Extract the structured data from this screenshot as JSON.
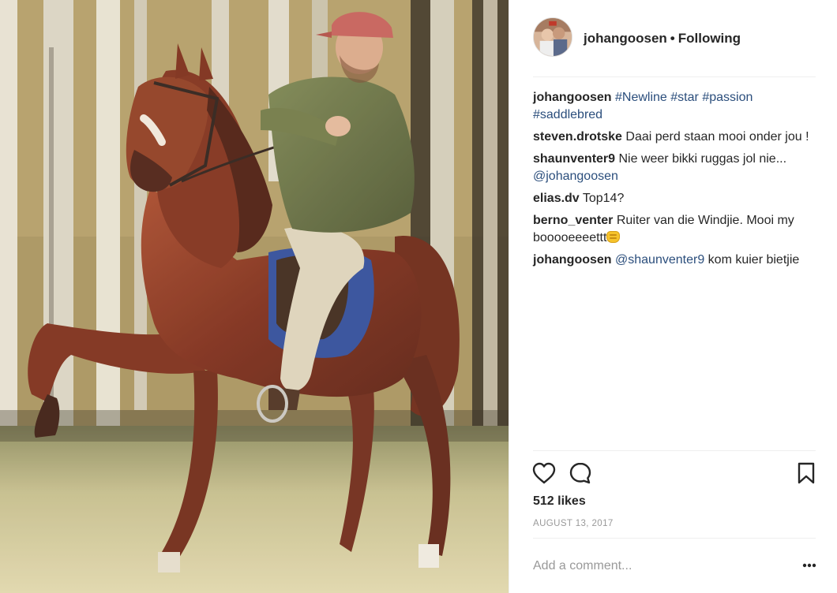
{
  "post": {
    "username": "johangoosen",
    "separator": "•",
    "follow_status": "Following",
    "image_alt": "Man riding a chestnut saddlebred horse through a birch forest",
    "comments": [
      {
        "user": "johangoosen",
        "parts": [
          {
            "type": "tag",
            "text": "#Newline"
          },
          {
            "type": "text",
            "text": " "
          },
          {
            "type": "tag",
            "text": "#star"
          },
          {
            "type": "text",
            "text": " "
          },
          {
            "type": "tag",
            "text": "#passion"
          },
          {
            "type": "text",
            "text": " "
          },
          {
            "type": "tag",
            "text": "#saddlebred"
          }
        ]
      },
      {
        "user": "steven.drotske",
        "parts": [
          {
            "type": "text",
            "text": "Daai perd staan mooi onder jou !"
          }
        ]
      },
      {
        "user": "shaunventer9",
        "parts": [
          {
            "type": "text",
            "text": "Nie weer bikki ruggas jol nie... "
          },
          {
            "type": "tag",
            "text": "@johangoosen"
          }
        ]
      },
      {
        "user": "elias.dv",
        "parts": [
          {
            "type": "text",
            "text": "Top14?"
          }
        ]
      },
      {
        "user": "berno_venter",
        "parts": [
          {
            "type": "text",
            "text": "Ruiter van die Windjie. Mooi my booooeeeettt"
          },
          {
            "type": "emoji",
            "text": "fist-emoji"
          }
        ]
      },
      {
        "user": "johangoosen",
        "parts": [
          {
            "type": "tag",
            "text": "@shaunventer9"
          },
          {
            "type": "text",
            "text": " kom kuier bietjie"
          }
        ]
      }
    ],
    "likes": "512 likes",
    "date": "AUGUST 13, 2017",
    "add_comment_placeholder": "Add a comment...",
    "icons": {
      "like": "heart-icon",
      "comment": "comment-bubble-icon",
      "save": "bookmark-icon",
      "more": "more-options-icon"
    }
  }
}
